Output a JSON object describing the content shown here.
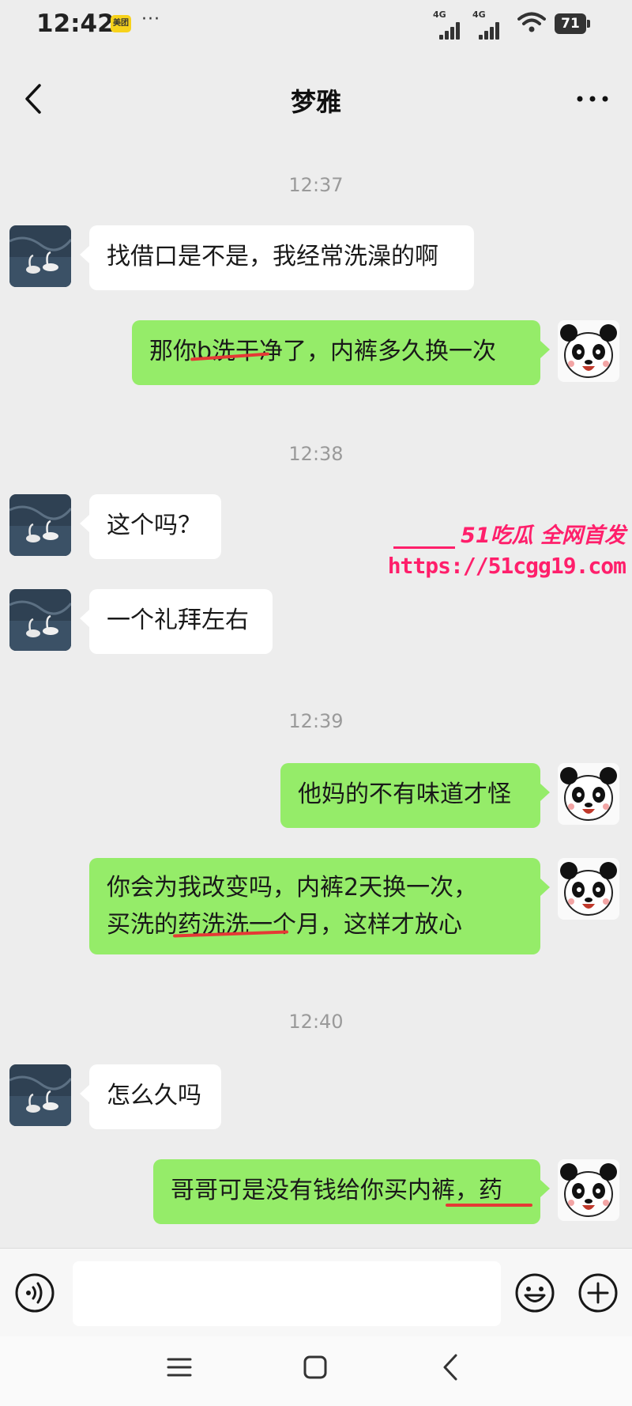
{
  "status_bar": {
    "time": "12:42",
    "app_badge": "美团",
    "more": "···",
    "signal1_label": "4G",
    "signal2_label": "4G",
    "battery": "71"
  },
  "header": {
    "title": "梦雅"
  },
  "messages": [
    {
      "type": "time",
      "text": "12:37"
    },
    {
      "type": "in",
      "text": "找借口是不是，我经常洗澡的啊"
    },
    {
      "type": "out",
      "text": "那你b洗干净了，内裤多久换一次"
    },
    {
      "type": "time",
      "text": "12:38"
    },
    {
      "type": "in",
      "text": "这个吗？"
    },
    {
      "type": "in",
      "text": "一个礼拜左右"
    },
    {
      "type": "time",
      "text": "12:39"
    },
    {
      "type": "out",
      "text": "他妈的不有味道才怪"
    },
    {
      "type": "out",
      "lines": [
        "你会为我改变吗，内裤2天换一次，",
        "买洗的药洗洗一个月，这样才放心"
      ]
    },
    {
      "type": "time",
      "text": "12:40"
    },
    {
      "type": "in",
      "text": "怎么久吗"
    },
    {
      "type": "out",
      "text": "哥哥可是没有钱给你买内裤，药"
    }
  ],
  "watermark": {
    "top": "51吃瓜 全网首发",
    "url": "https://51cgg19.com"
  },
  "colors": {
    "background": "#ededed",
    "incoming_bubble": "#ffffff",
    "outgoing_bubble": "#95ec69",
    "watermark": "#ff1f6b",
    "underline": "#e53935"
  },
  "icons": {
    "back": "chevron-left-icon",
    "more": "more-dots-icon",
    "voice": "voice-icon",
    "emoji": "emoji-icon",
    "plus": "plus-icon"
  }
}
